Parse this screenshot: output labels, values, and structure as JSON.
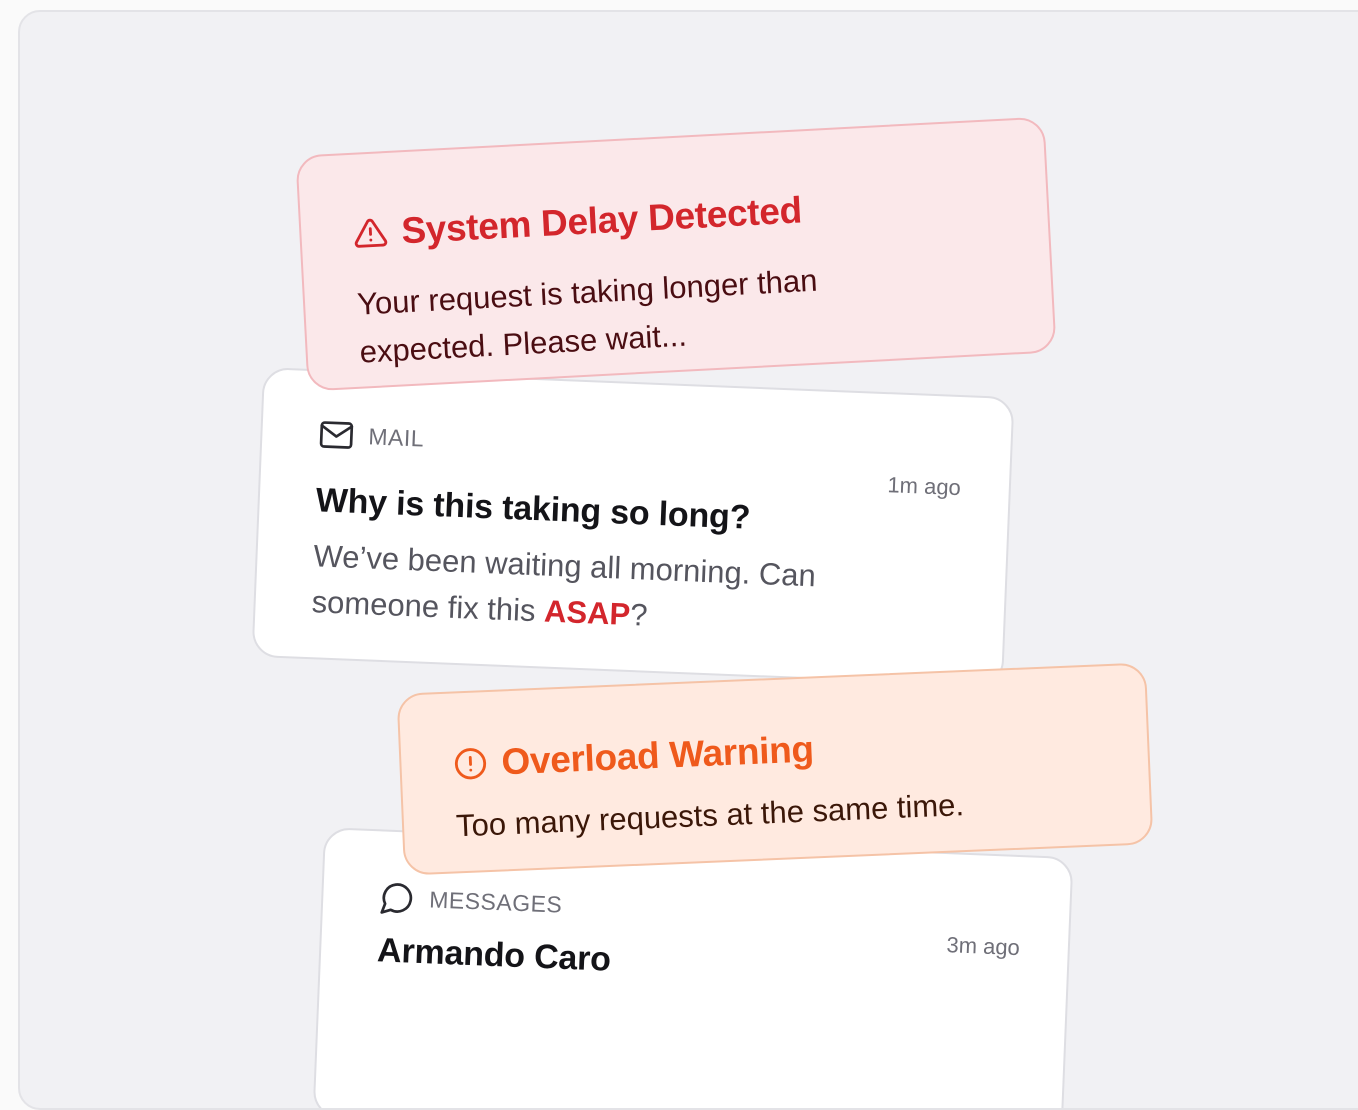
{
  "notifications": {
    "system_delay": {
      "icon": "warning-triangle-icon",
      "title": "System Delay Detected",
      "body": "Your request is taking longer than expected. Please wait...",
      "accent": "#d3262c"
    },
    "mail": {
      "icon": "mail-icon",
      "app": "MAIL",
      "time": "1m ago",
      "subject": "Why is this taking so long?",
      "preview_prefix": "We’ve been waiting all morning. Can someone fix this ",
      "preview_highlight": "ASAP",
      "preview_suffix": "?"
    },
    "overload": {
      "icon": "alert-circle-icon",
      "title": "Overload Warning",
      "body": "Too many requests at the same time.",
      "accent": "#ef5a1c"
    },
    "messages": {
      "icon": "chat-bubble-icon",
      "app": "MESSAGES",
      "time": "3m ago",
      "sender": "Armando Caro"
    }
  }
}
